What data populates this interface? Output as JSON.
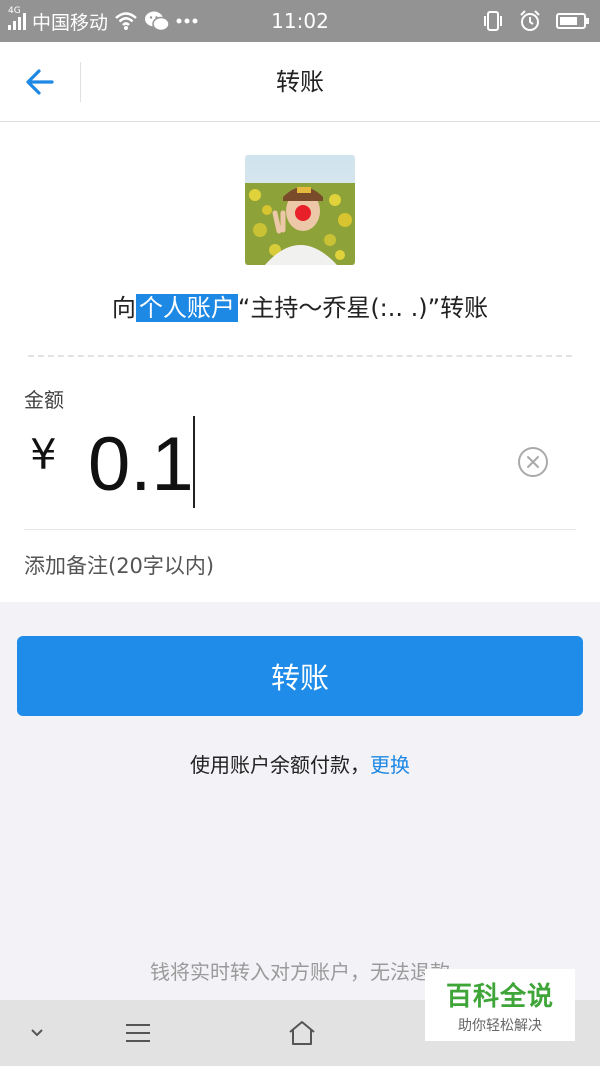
{
  "status_bar": {
    "carrier": "中国移动",
    "time": "11:02",
    "network": "4G",
    "battery_level": 0.75
  },
  "nav": {
    "title": "转账",
    "back_icon": "arrow-left-icon"
  },
  "recipient": {
    "prefix": "向",
    "account_type": "个人账户",
    "name": "“主持～乔星(:.. .)”",
    "suffix": "转账"
  },
  "amount": {
    "label": "金额",
    "currency": "¥",
    "value": "0.1"
  },
  "note": {
    "placeholder": "添加备注(20字以内)"
  },
  "actions": {
    "transfer_label": "转账",
    "pay_text": "使用账户余额付款，",
    "change_label": "更换"
  },
  "footer_note": "钱将实时转入对方账户，无法退款",
  "watermark": {
    "title": "百科全说",
    "subtitle": "助你轻松解决"
  },
  "colors": {
    "accent": "#1e8ce8",
    "status_bar": "#939393",
    "watermark_green": "#3fa539"
  }
}
